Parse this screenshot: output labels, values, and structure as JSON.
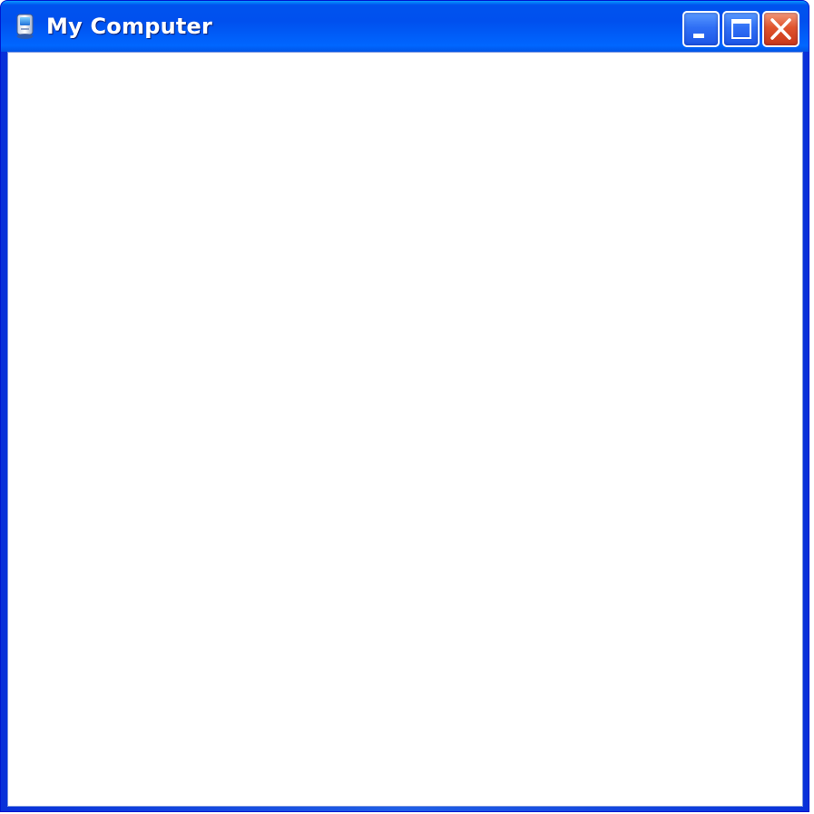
{
  "window": {
    "title": "My Computer",
    "icon": "computer-icon",
    "controls": {
      "minimize_icon": "minimize-icon",
      "maximize_icon": "maximize-icon",
      "close_icon": "close-icon"
    }
  },
  "colors": {
    "titlebar": "#0053ee",
    "frame": "#0831d9",
    "close_button": "#e0542d",
    "client_background": "#ffffff"
  }
}
